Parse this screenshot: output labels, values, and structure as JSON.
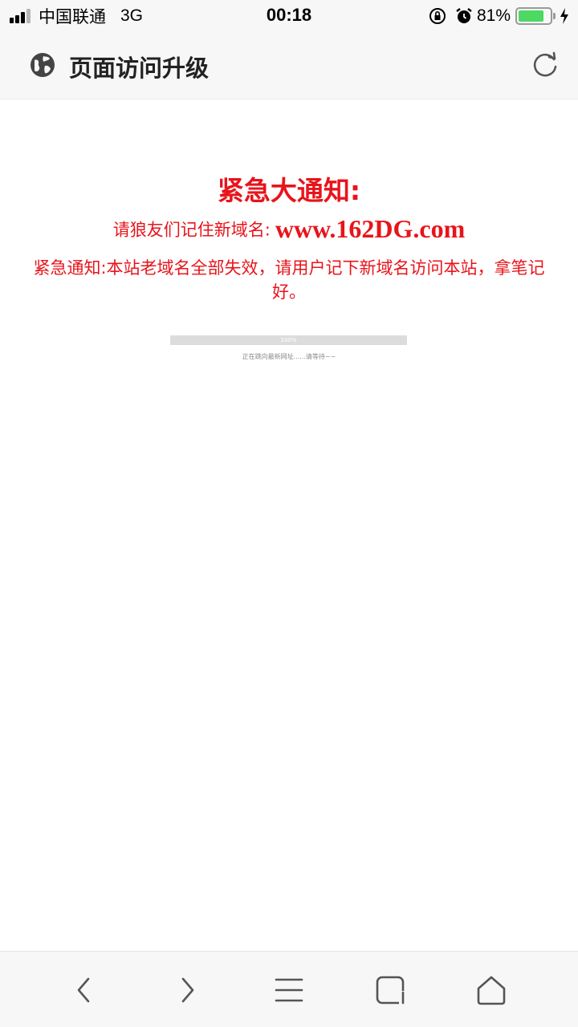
{
  "status_bar": {
    "carrier": "中国联通",
    "network": "3G",
    "time": "00:18",
    "battery_percent": "81%",
    "battery_level": 0.81,
    "icons": [
      "signal-icon",
      "rotation-lock-icon",
      "alarm-icon",
      "battery-icon",
      "charging-icon"
    ]
  },
  "header": {
    "title": "页面访问升级",
    "left_icon": "globe-icon",
    "right_icon": "refresh-icon"
  },
  "main": {
    "headline": "紧急大通知:",
    "domain_prefix": "请狼友们记住新域名:",
    "domain_url": "www.162DG.com",
    "notice": "紧急通知:本站老域名全部失效，请用户记下新域名访问本站，拿笔记好。",
    "progress_label": "100%",
    "progress_value": 1.0,
    "redirect_text": "正在跳向最新网址......请等待~~"
  },
  "colors": {
    "accent": "#e8141b",
    "bar_background": "#f7f7f7"
  },
  "bottom_nav": {
    "icons": [
      "back-icon",
      "forward-icon",
      "menu-icon",
      "tabs-icon",
      "home-icon"
    ]
  }
}
